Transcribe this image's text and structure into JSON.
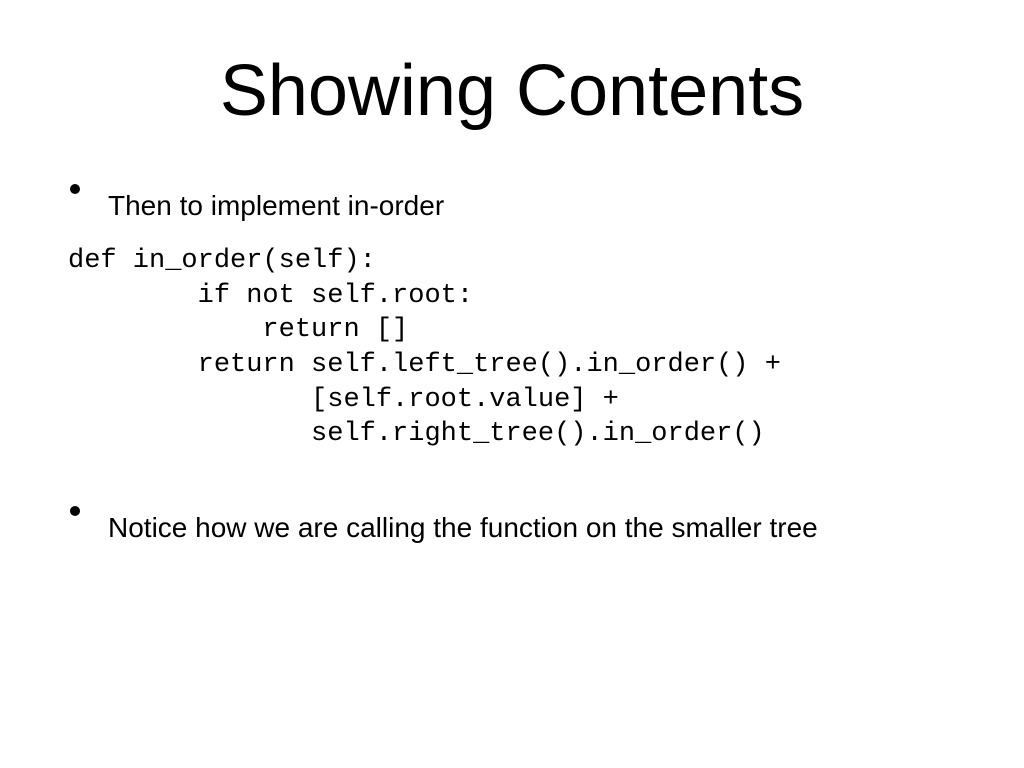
{
  "title": "Showing Contents",
  "bullets": {
    "first": "Then to implement in-order",
    "second": "Notice how we are calling the function on the smaller tree"
  },
  "code": "def in_order(self):\n        if not self.root:\n            return []\n        return self.left_tree().in_order() +\n               [self.root.value] +\n               self.right_tree().in_order()"
}
